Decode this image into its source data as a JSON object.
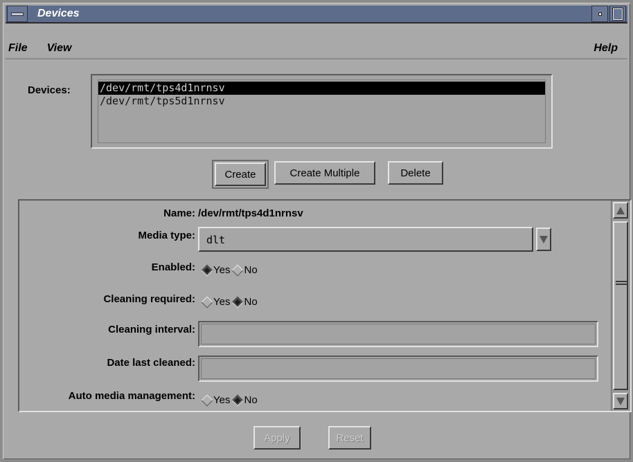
{
  "window": {
    "title": "Devices"
  },
  "menubar": {
    "items": [
      {
        "label": "File",
        "mnemonic": "F"
      },
      {
        "label": "View",
        "mnemonic": "V"
      }
    ],
    "help": {
      "label": "Help",
      "mnemonic": "H"
    }
  },
  "devices": {
    "label": "Devices:",
    "items": [
      {
        "path": "/dev/rmt/tps4d1nrnsv",
        "selected": true
      },
      {
        "path": "/dev/rmt/tps5d1nrnsv",
        "selected": false
      }
    ]
  },
  "actions": {
    "create": "Create",
    "create_multiple": "Create Multiple",
    "delete": "Delete"
  },
  "details": {
    "name": {
      "label": "Name:",
      "value": "/dev/rmt/tps4d1nrnsv"
    },
    "media_type": {
      "label": "Media type:",
      "value": "dlt"
    },
    "enabled": {
      "label": "Enabled:",
      "yes": "Yes",
      "no": "No",
      "selected": "Yes"
    },
    "cleaning_required": {
      "label": "Cleaning required:",
      "yes": "Yes",
      "no": "No",
      "selected": "No"
    },
    "cleaning_interval": {
      "label": "Cleaning interval:",
      "value": ""
    },
    "date_last_cleaned": {
      "label": "Date last cleaned:",
      "value": ""
    },
    "auto_media_management": {
      "label": "Auto media management:",
      "yes": "Yes",
      "no": "No",
      "selected": "No"
    }
  },
  "footer": {
    "apply": "Apply",
    "reset": "Reset"
  },
  "colors": {
    "titlebar": "#5d6c8a",
    "background": "#a9a9a9",
    "selection": "#000000"
  }
}
